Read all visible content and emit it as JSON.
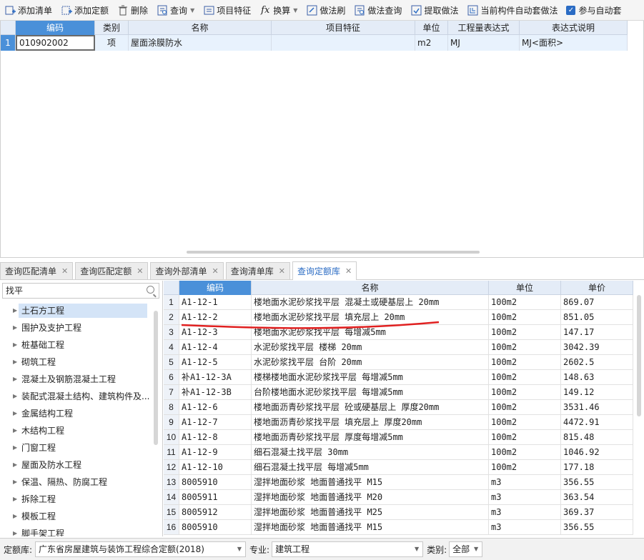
{
  "toolbar": {
    "items": [
      {
        "label": "添加清单",
        "icon": "add-list-icon"
      },
      {
        "label": "添加定额",
        "icon": "add-quota-icon"
      },
      {
        "label": "删除",
        "icon": "trash-icon"
      },
      {
        "label": "查询",
        "icon": "query-icon",
        "dropdown": true
      },
      {
        "label": "项目特征",
        "icon": "feature-icon"
      },
      {
        "label": "换算",
        "icon": "fx-icon",
        "dropdown": true
      },
      {
        "label": "做法刷",
        "icon": "brush-icon"
      },
      {
        "label": "做法查询",
        "icon": "method-query-icon"
      },
      {
        "label": "提取做法",
        "icon": "extract-icon"
      },
      {
        "label": "当前构件自动套做法",
        "icon": "auto-apply-icon"
      }
    ],
    "checkbox_label": "参与自动套",
    "checkbox_checked": true
  },
  "top_grid": {
    "headers": [
      "编码",
      "类别",
      "名称",
      "项目特征",
      "单位",
      "工程量表达式",
      "表达式说明"
    ],
    "rows": [
      {
        "index": "1",
        "code": "010902002",
        "type": "项",
        "name": "屋面涂膜防水",
        "feature": "",
        "unit": "m2",
        "expr": "MJ",
        "desc": "MJ<面积>"
      }
    ]
  },
  "tabs": [
    {
      "label": "查询匹配清单",
      "active": false
    },
    {
      "label": "查询匹配定额",
      "active": false
    },
    {
      "label": "查询外部清单",
      "active": false
    },
    {
      "label": "查询清单库",
      "active": false
    },
    {
      "label": "查询定额库",
      "active": true
    }
  ],
  "search": {
    "value": "找平"
  },
  "tree": [
    "土石方工程",
    "围护及支护工程",
    "桩基础工程",
    "砌筑工程",
    "混凝土及钢筋混凝土工程",
    "装配式混凝土结构、建筑构件及...",
    "金属结构工程",
    "木结构工程",
    "门窗工程",
    "屋面及防水工程",
    "保温、隔热、防腐工程",
    "拆除工程",
    "模板工程",
    "脚手架工程"
  ],
  "quota_grid": {
    "headers": [
      "编码",
      "名称",
      "单位",
      "单价"
    ],
    "rows": [
      {
        "index": "1",
        "code": "A1-12-1",
        "name": "楼地面水泥砂浆找平层 混凝土或硬基层上 20mm",
        "unit": "100m2",
        "price": "869.07"
      },
      {
        "index": "2",
        "code": "A1-12-2",
        "name": "楼地面水泥砂浆找平层 填充层上 20mm",
        "unit": "100m2",
        "price": "851.05"
      },
      {
        "index": "3",
        "code": "A1-12-3",
        "name": "楼地面水泥砂浆找平层 每增减5mm",
        "unit": "100m2",
        "price": "147.17"
      },
      {
        "index": "4",
        "code": "A1-12-4",
        "name": "水泥砂浆找平层 楼梯 20mm",
        "unit": "100m2",
        "price": "3042.39"
      },
      {
        "index": "5",
        "code": "A1-12-5",
        "name": "水泥砂浆找平层 台阶 20mm",
        "unit": "100m2",
        "price": "2602.5"
      },
      {
        "index": "6",
        "code": "补A1-12-3A",
        "name": "楼梯楼地面水泥砂浆找平层 每增减5mm",
        "unit": "100m2",
        "price": "148.63"
      },
      {
        "index": "7",
        "code": "补A1-12-3B",
        "name": "台阶楼地面水泥砂浆找平层 每增减5mm",
        "unit": "100m2",
        "price": "149.12"
      },
      {
        "index": "8",
        "code": "A1-12-6",
        "name": "楼地面沥青砂浆找平层 砼或硬基层上 厚度20mm",
        "unit": "100m2",
        "price": "3531.46"
      },
      {
        "index": "9",
        "code": "A1-12-7",
        "name": "楼地面沥青砂浆找平层 填充层上 厚度20mm",
        "unit": "100m2",
        "price": "4472.91"
      },
      {
        "index": "10",
        "code": "A1-12-8",
        "name": "楼地面沥青砂浆找平层 厚度每增减5mm",
        "unit": "100m2",
        "price": "815.48"
      },
      {
        "index": "11",
        "code": "A1-12-9",
        "name": "细石混凝土找平层 30mm",
        "unit": "100m2",
        "price": "1046.92"
      },
      {
        "index": "12",
        "code": "A1-12-10",
        "name": "细石混凝土找平层 每增减5mm",
        "unit": "100m2",
        "price": "177.18"
      },
      {
        "index": "13",
        "code": "8005910",
        "name": "湿拌地面砂浆 地面普通找平 M15",
        "unit": "m3",
        "price": "356.55"
      },
      {
        "index": "14",
        "code": "8005911",
        "name": "湿拌地面砂浆 地面普通找平 M20",
        "unit": "m3",
        "price": "363.54"
      },
      {
        "index": "15",
        "code": "8005912",
        "name": "湿拌地面砂浆 地面普通找平 M25",
        "unit": "m3",
        "price": "369.37"
      },
      {
        "index": "16",
        "code": "8005910",
        "name": "湿拌地面砂浆 地面普通找平 M15",
        "unit": "m3",
        "price": "356.55"
      }
    ]
  },
  "bottom": {
    "quota_lib_label": "定额库:",
    "quota_lib_value": "广东省房屋建筑与装饰工程综合定额(2018)",
    "major_label": "专业:",
    "major_value": "建筑工程",
    "category_label": "类别:",
    "category_value": "全部"
  },
  "colors": {
    "accent": "#2b6cc4",
    "header_bg": "#e4ecf7",
    "annotation": "#e02020"
  }
}
